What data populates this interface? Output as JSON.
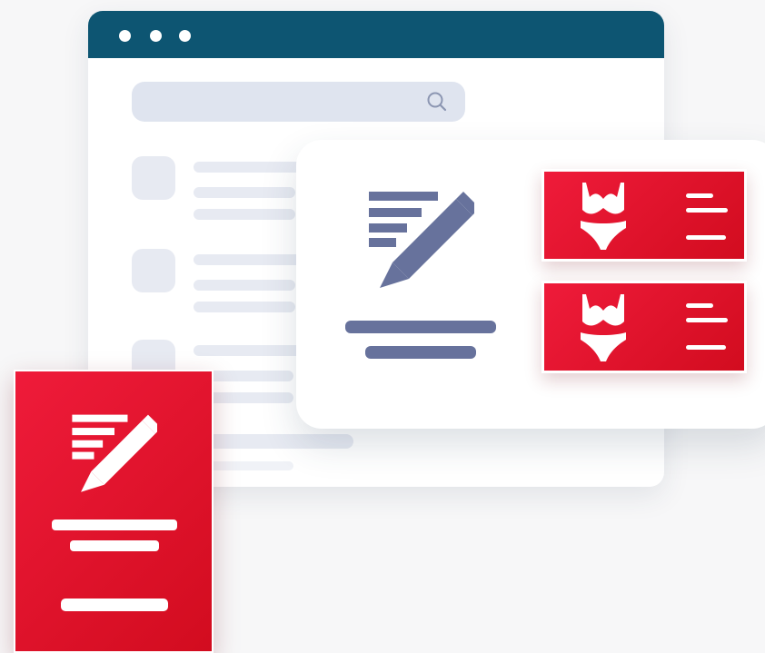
{
  "browser": {
    "window_dots": [
      "dot-1",
      "dot-2",
      "dot-3"
    ],
    "titlebar_color": "#0d5572",
    "search": {
      "icon": "search-icon",
      "placeholder": ""
    }
  },
  "editor_card": {
    "icon": "compose-pencil-icon",
    "icon_color": "#67729c"
  },
  "product_cards": [
    {
      "icon": "lingerie-icon"
    },
    {
      "icon": "lingerie-icon"
    }
  ],
  "front_document": {
    "icon": "compose-pencil-icon",
    "accent": "#e3112a"
  }
}
